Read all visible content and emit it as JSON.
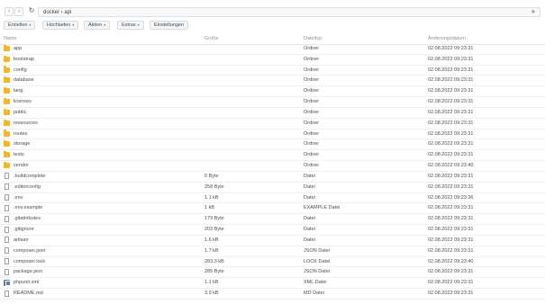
{
  "address": {
    "back_icon": "‹",
    "forward_icon": "›",
    "refresh_icon": "↻",
    "path": "docker › api",
    "star_icon": "★"
  },
  "toolbar": {
    "buttons": [
      {
        "label": "Erstellen",
        "dropdown": true
      },
      {
        "label": "Hochladen",
        "dropdown": true
      },
      {
        "label": "Aktion",
        "dropdown": true
      },
      {
        "label": "Extras",
        "dropdown": true
      },
      {
        "label": "Einstellungen",
        "dropdown": false
      }
    ],
    "caret": "▾"
  },
  "table": {
    "columns": [
      "Name",
      "Größe",
      "Dateityp",
      "Änderungsdatum"
    ],
    "rows": [
      {
        "icon": "folder-icon",
        "name": "app",
        "size": "",
        "type": "Ordner",
        "date": "02.08.2022 09:23:31"
      },
      {
        "icon": "folder-icon",
        "name": "bootstrap",
        "size": "",
        "type": "Ordner",
        "date": "02.08.2022 09:23:31"
      },
      {
        "icon": "folder-icon",
        "name": "config",
        "size": "",
        "type": "Ordner",
        "date": "02.08.2022 09:23:31"
      },
      {
        "icon": "folder-icon",
        "name": "database",
        "size": "",
        "type": "Ordner",
        "date": "02.08.2022 09:23:31"
      },
      {
        "icon": "folder-icon",
        "name": "lang",
        "size": "",
        "type": "Ordner",
        "date": "02.08.2022 09:23:31"
      },
      {
        "icon": "folder-icon",
        "name": "licenses",
        "size": "",
        "type": "Ordner",
        "date": "02.08.2022 09:23:31"
      },
      {
        "icon": "folder-icon",
        "name": "public",
        "size": "",
        "type": "Ordner",
        "date": "02.08.2022 09:23:31"
      },
      {
        "icon": "folder-icon",
        "name": "ressources",
        "size": "",
        "type": "Ordner",
        "date": "02.08.2022 09:23:31"
      },
      {
        "icon": "folder-icon",
        "name": "routes",
        "size": "",
        "type": "Ordner",
        "date": "02.08.2022 09:23:31"
      },
      {
        "icon": "folder-icon",
        "name": "storage",
        "size": "",
        "type": "Ordner",
        "date": "02.08.2022 09:23:31"
      },
      {
        "icon": "folder-icon",
        "name": "tests",
        "size": "",
        "type": "Ordner",
        "date": "02.08.2022 09:23:31"
      },
      {
        "icon": "folder-icon",
        "name": "vendor",
        "size": "",
        "type": "Ordner",
        "date": "02.08.2022 09:23:40"
      },
      {
        "icon": "file-icon",
        "name": ".buildcomplete",
        "size": "0 Byte",
        "type": "Datei",
        "date": "02.08.2022 09:23:31"
      },
      {
        "icon": "file-icon",
        "name": ".editorconfig",
        "size": "258 Byte",
        "type": "Datei",
        "date": "02.08.2022 09:23:31"
      },
      {
        "icon": "file-icon",
        "name": ".env",
        "size": "1.1 kB",
        "type": "Datei",
        "date": "02.08.2022 09:23:36"
      },
      {
        "icon": "file-icon",
        "name": ".env.example",
        "size": "1 kB",
        "type": "EXAMPLE Datei",
        "date": "02.08.2022 09:23:31"
      },
      {
        "icon": "file-icon",
        "name": ".gitattributes",
        "size": "179 Byte",
        "type": "Datei",
        "date": "02.08.2022 09:23:31"
      },
      {
        "icon": "file-icon",
        "name": ".gitignore",
        "size": "203 Byte",
        "type": "Datei",
        "date": "02.08.2022 09:23:31"
      },
      {
        "icon": "file-icon",
        "name": "artisan",
        "size": "1.6 kB",
        "type": "Datei",
        "date": "02.08.2022 09:23:31"
      },
      {
        "icon": "file-icon",
        "name": "composer.json",
        "size": "1.7 kB",
        "type": "JSON Datei",
        "date": "02.08.2022 09:23:31"
      },
      {
        "icon": "file-icon",
        "name": "composer.lock",
        "size": "283.3 kB",
        "type": "LOCK Datei",
        "date": "02.08.2022 09:23:40"
      },
      {
        "icon": "file-icon",
        "name": "package.json",
        "size": "285 Byte",
        "type": "JSON Datei",
        "date": "02.08.2022 09:23:31"
      },
      {
        "icon": "xml-file-icon",
        "name": "phpunit.xml",
        "size": "1.1 kB",
        "type": "XML Datei",
        "date": "02.08.2022 09:23:31"
      },
      {
        "icon": "file-icon",
        "name": "README.md",
        "size": "3.9 kB",
        "type": "MD Datei",
        "date": "02.08.2022 09:23:31"
      }
    ]
  }
}
